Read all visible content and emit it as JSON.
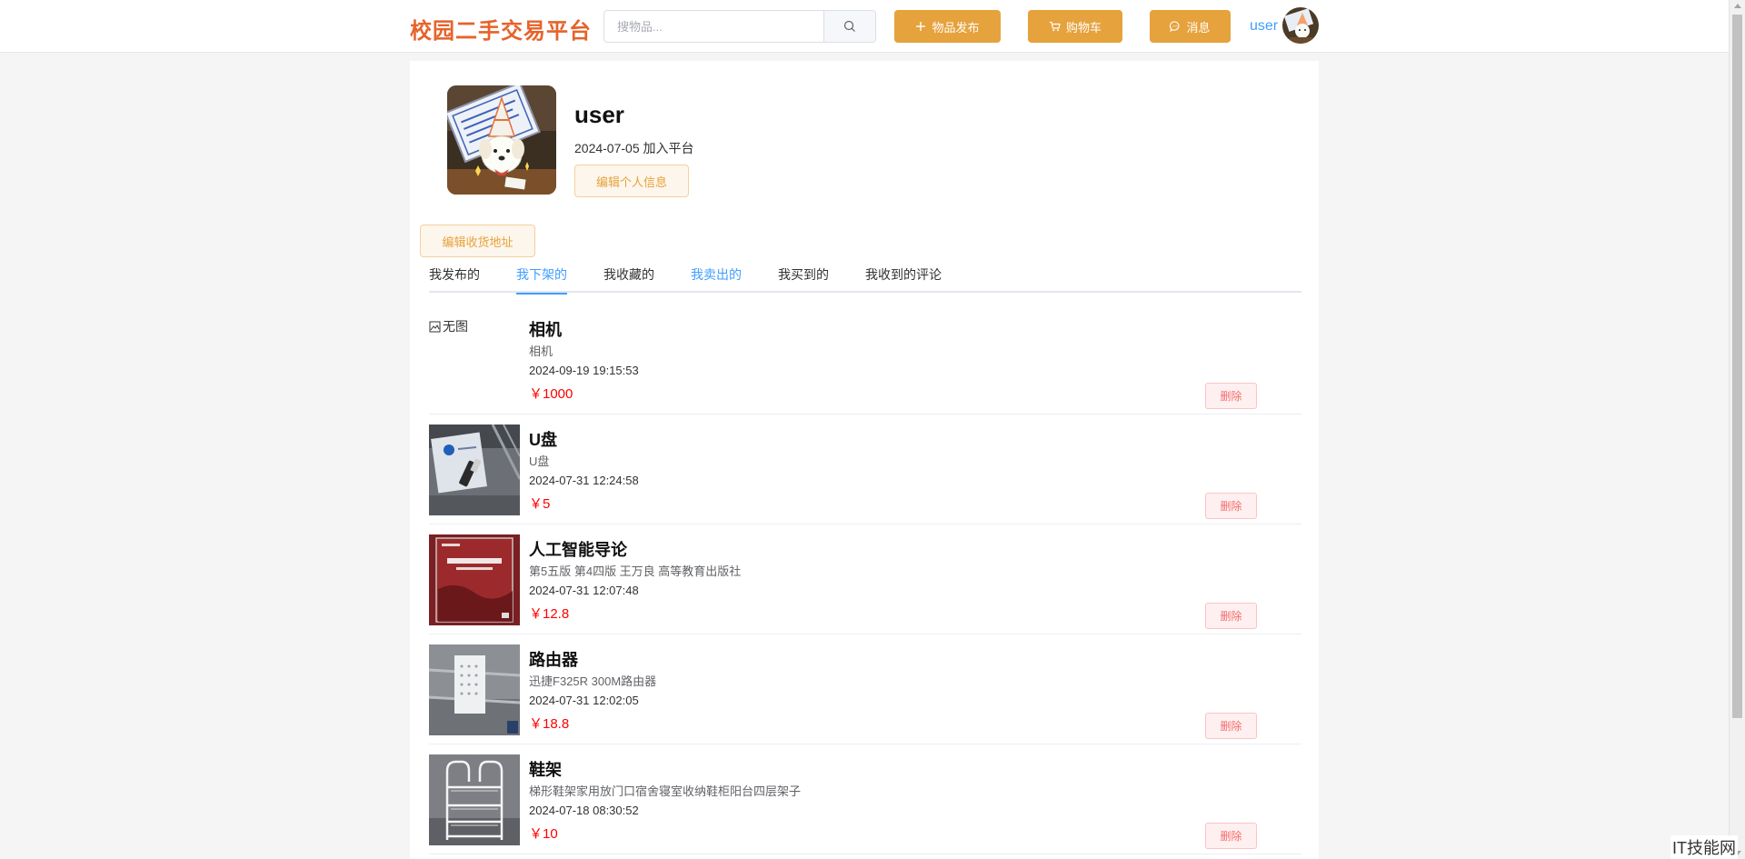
{
  "header": {
    "logo": "校园二手交易平台",
    "search_placeholder": "搜物品...",
    "publish_label": "物品发布",
    "cart_label": "购物车",
    "message_label": "消息",
    "username": "user"
  },
  "profile": {
    "name": "user",
    "joined": "2024-07-05 加入平台",
    "edit_profile_label": "编辑个人信息",
    "edit_address_label": "编辑收货地址"
  },
  "tabs": [
    {
      "label": "我发布的",
      "state": "normal"
    },
    {
      "label": "我下架的",
      "state": "active"
    },
    {
      "label": "我收藏的",
      "state": "normal"
    },
    {
      "label": "我卖出的",
      "state": "highlight"
    },
    {
      "label": "我买到的",
      "state": "normal"
    },
    {
      "label": "我收到的评论",
      "state": "normal"
    }
  ],
  "items": [
    {
      "no_image_text": "无图",
      "title": "相机",
      "description": "相机",
      "date": "2024-09-19 19:15:53",
      "price": "￥1000",
      "delete_label": "删除"
    },
    {
      "title": "U盘",
      "description": "U盘",
      "date": "2024-07-31 12:24:58",
      "price": "￥5",
      "delete_label": "删除"
    },
    {
      "title": "人工智能导论",
      "description": "第5五版 第4四版 王万良 高等教育出版社",
      "date": "2024-07-31 12:07:48",
      "price": "￥12.8",
      "delete_label": "删除"
    },
    {
      "title": "路由器",
      "description": "迅捷F325R 300M路由器",
      "date": "2024-07-31 12:02:05",
      "price": "￥18.8",
      "delete_label": "删除"
    },
    {
      "title": "鞋架",
      "description": "梯形鞋架家用放门口宿舍寝室收纳鞋柜阳台四层架子",
      "date": "2024-07-18 08:30:52",
      "price": "￥10",
      "delete_label": "删除"
    }
  ],
  "watermark": "IT技能网",
  "icons": {
    "search": "search-icon",
    "publish": "plus-icon",
    "cart": "cart-icon",
    "message": "chat-bubble-icon",
    "no_image": "broken-image-icon"
  },
  "colors": {
    "logo": "#e6632a",
    "accent_button": "#e6a23c",
    "link_blue": "#409eff",
    "price_red": "#ff0000",
    "delete_red": "#f56c6c"
  }
}
